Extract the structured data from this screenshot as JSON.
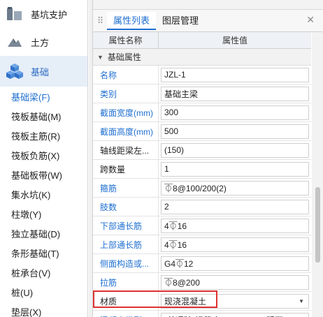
{
  "nav": {
    "categories": [
      {
        "label": "基坑支护",
        "icon": "retaining-wall-icon"
      },
      {
        "label": "土方",
        "icon": "earthwork-icon"
      },
      {
        "label": "基础",
        "icon": "foundation-cubes-icon",
        "active": true
      }
    ],
    "sub_items": [
      {
        "label": "基础梁(F)",
        "active": true
      },
      {
        "label": "筏板基础(M)"
      },
      {
        "label": "筏板主筋(R)"
      },
      {
        "label": "筏板负筋(X)"
      },
      {
        "label": "基础板带(W)"
      },
      {
        "label": "集水坑(K)"
      },
      {
        "label": "柱墩(Y)"
      },
      {
        "label": "独立基础(D)"
      },
      {
        "label": "条形基础(T)"
      },
      {
        "label": "桩承台(V)"
      },
      {
        "label": "桩(U)"
      },
      {
        "label": "垫层(X)"
      }
    ]
  },
  "panel": {
    "tabs": [
      "属性列表",
      "图层管理"
    ],
    "header": {
      "name": "属性名称",
      "value": "属性值"
    },
    "section": "基础属性",
    "properties": [
      {
        "name": "名称",
        "value": "JZL-1",
        "blue": true
      },
      {
        "name": "类别",
        "value": "基础主梁",
        "blue": true
      },
      {
        "name": "截面宽度(mm)",
        "value": "300",
        "blue": true
      },
      {
        "name": "截面高度(mm)",
        "value": "500",
        "blue": true
      },
      {
        "name": "轴线距梁左...",
        "value": "(150)",
        "blue": false
      },
      {
        "name": "跨数量",
        "value": "1",
        "blue": false
      },
      {
        "name": "箍筋",
        "value": "⏁8@100/200(2)",
        "blue": true
      },
      {
        "name": "肢数",
        "value": "2",
        "blue": true
      },
      {
        "name": "下部通长筋",
        "value": "4⏁16",
        "blue": true
      },
      {
        "name": "上部通长筋",
        "value": "4⏁16",
        "blue": true
      },
      {
        "name": "侧面构造或...",
        "value": "G4⏁12",
        "blue": true
      },
      {
        "name": "拉筋",
        "value": "⏁8@200",
        "blue": true
      },
      {
        "name": "材质",
        "value": "现浇混凝土",
        "blue": false,
        "dropdown": true
      },
      {
        "name": "混凝土类型",
        "value": "(普通砼(坍落度10～90mm),砾石5～...",
        "blue": true
      }
    ]
  },
  "colors": {
    "accent": "#1f6fd0",
    "highlight": "#e03131",
    "active_bg": "#e6eef8"
  }
}
